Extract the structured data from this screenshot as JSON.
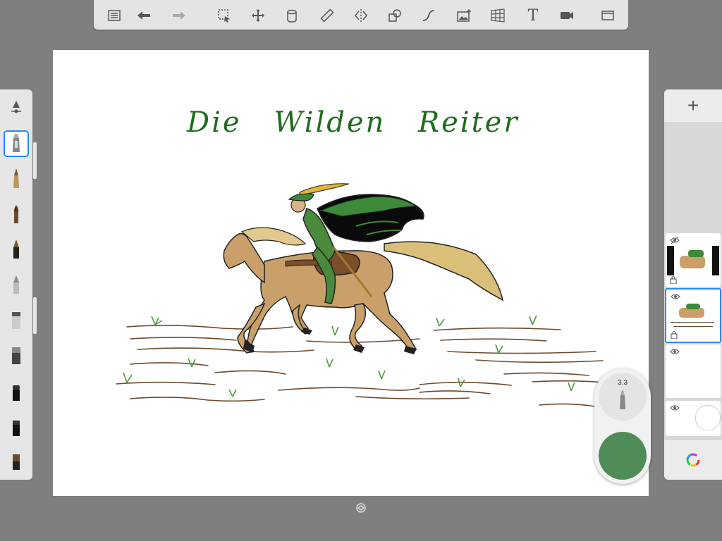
{
  "toolbar": {
    "items": [
      {
        "name": "list",
        "icon": "list-icon"
      },
      {
        "name": "undo",
        "icon": "undo-arrow-icon"
      },
      {
        "name": "redo",
        "icon": "redo-arrow-icon"
      },
      {
        "name": "select",
        "icon": "selection-icon"
      },
      {
        "name": "transform",
        "icon": "move-icon"
      },
      {
        "name": "fill",
        "icon": "paint-bucket-icon"
      },
      {
        "name": "ruler",
        "icon": "ruler-icon"
      },
      {
        "name": "symmetry",
        "icon": "symmetry-icon"
      },
      {
        "name": "shape",
        "icon": "shape-icon"
      },
      {
        "name": "curve",
        "icon": "curve-icon"
      },
      {
        "name": "image",
        "icon": "image-add-icon"
      },
      {
        "name": "perspective",
        "icon": "perspective-grid-icon"
      },
      {
        "name": "text",
        "icon": "text-icon",
        "label": "T"
      },
      {
        "name": "record",
        "icon": "video-icon"
      },
      {
        "name": "fullscreen",
        "icon": "fullscreen-icon"
      }
    ]
  },
  "canvas": {
    "title_text": "Die  Wilden  Reiter"
  },
  "brush_panel": {
    "brushes": [
      "pencil",
      "ink-pen",
      "paintbrush",
      "marker",
      "airbrush",
      "smudge",
      "eraser",
      "solid-brush",
      "fine-brush",
      "texture-brush"
    ],
    "selected": "pencil"
  },
  "puck": {
    "size_value": "3.3",
    "color": "#4f8c57"
  },
  "layers": {
    "add_label": "+",
    "items": [
      {
        "visible": "hidden"
      },
      {
        "visible": "shown",
        "selected": true
      },
      {
        "visible": "shown"
      },
      {
        "visible": "shown"
      }
    ]
  }
}
